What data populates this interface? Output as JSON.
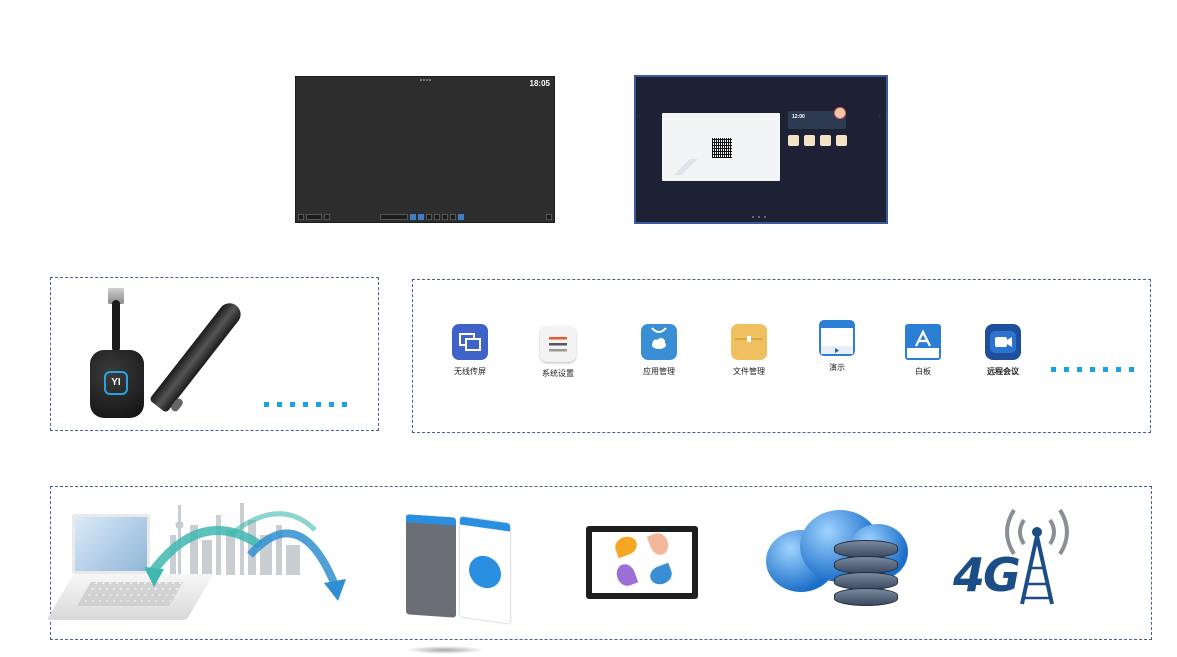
{
  "top_screens": {
    "dark_screen": {
      "clock": "18:05"
    },
    "blue_screen": {
      "widget_time": "12:00"
    }
  },
  "hardware_panel": {
    "dongle_logo": "YI"
  },
  "apps_panel": {
    "apps": [
      {
        "label": "无线传屏",
        "icon": "screen-cast-icon",
        "color": "#3f63c8"
      },
      {
        "label": "系统设置",
        "icon": "settings-icon",
        "color": "#f2f2f2"
      },
      {
        "label": "应用管理",
        "icon": "app-store-icon",
        "color": "#3a8fd4"
      },
      {
        "label": "文件管理",
        "icon": "folder-icon",
        "color": "#f0c060"
      },
      {
        "label": "演示",
        "icon": "presentation-icon",
        "color": "#2a7fd4"
      },
      {
        "label": "白板",
        "icon": "whiteboard-icon",
        "color": "#2a7fd4"
      },
      {
        "label": "远程会议",
        "icon": "video-meeting-icon",
        "color": "#1e4f9a"
      }
    ]
  },
  "colors": {
    "accent": "#19a3e3",
    "panel_border": "#4a5e9a",
    "text_4g": "#1b4d86"
  },
  "bottom_panel": {
    "network_label": "4G"
  }
}
